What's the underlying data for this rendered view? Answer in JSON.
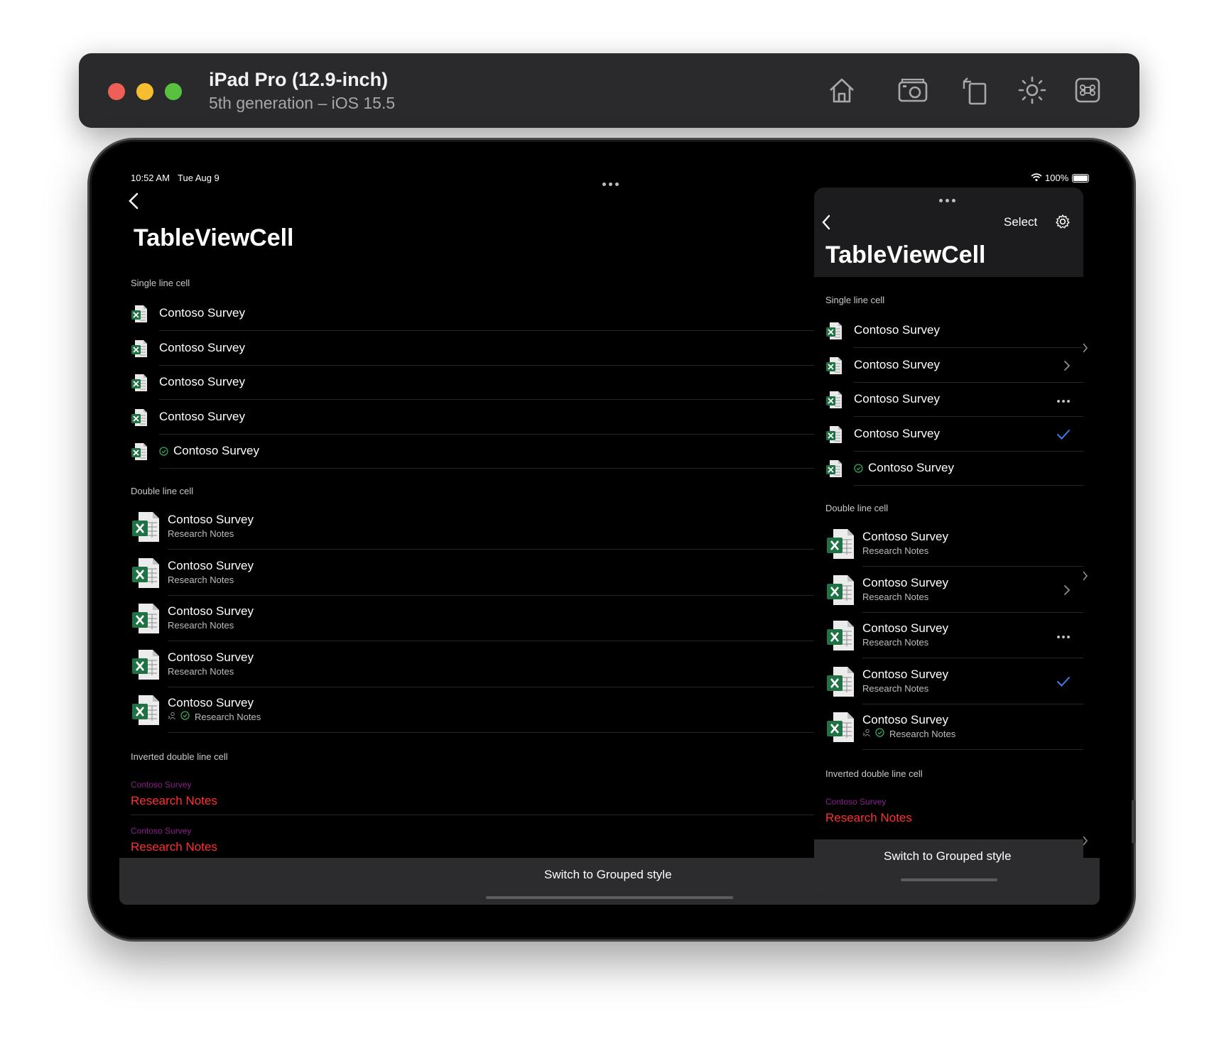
{
  "simulator": {
    "device_name": "iPad Pro (12.9-inch)",
    "device_detail": "5th generation – iOS 15.5",
    "toolbar_icons": [
      "home-icon",
      "screenshot-icon",
      "rotate-icon",
      "appearance-icon",
      "command-icon"
    ]
  },
  "status_bar": {
    "time": "10:52 AM",
    "date": "Tue Aug 9",
    "battery": "100%"
  },
  "main": {
    "title": "TableViewCell",
    "single_section": "Single line cell",
    "single_rows": [
      "Contoso Survey",
      "Contoso Survey",
      "Contoso Survey",
      "Contoso Survey",
      "Contoso Survey"
    ],
    "double_section": "Double line cell",
    "double_rows": [
      {
        "title": "Contoso Survey",
        "subtitle": "Research Notes"
      },
      {
        "title": "Contoso Survey",
        "subtitle": "Research Notes"
      },
      {
        "title": "Contoso Survey",
        "subtitle": "Research Notes"
      },
      {
        "title": "Contoso Survey",
        "subtitle": "Research Notes"
      },
      {
        "title": "Contoso Survey",
        "subtitle": "Research Notes"
      }
    ],
    "inverted_section": "Inverted double line cell",
    "inverted_rows": [
      {
        "top": "Contoso Survey",
        "bottom": "Research Notes"
      },
      {
        "top": "Contoso Survey",
        "bottom": "Research Notes"
      }
    ],
    "bottom_button": "Switch to Grouped style"
  },
  "popover": {
    "select_label": "Select",
    "title": "TableViewCell",
    "single_section": "Single line cell",
    "single_rows": [
      {
        "label": "Contoso Survey",
        "accessory": "none"
      },
      {
        "label": "Contoso Survey",
        "accessory": "chevron"
      },
      {
        "label": "Contoso Survey",
        "accessory": "more"
      },
      {
        "label": "Contoso Survey",
        "accessory": "checkmark"
      },
      {
        "label": "Contoso Survey",
        "accessory": "none"
      }
    ],
    "double_section": "Double line cell",
    "double_rows": [
      {
        "title": "Contoso Survey",
        "subtitle": "Research Notes",
        "accessory": "none"
      },
      {
        "title": "Contoso Survey",
        "subtitle": "Research Notes",
        "accessory": "chevron"
      },
      {
        "title": "Contoso Survey",
        "subtitle": "Research Notes",
        "accessory": "more"
      },
      {
        "title": "Contoso Survey",
        "subtitle": "Research Notes",
        "accessory": "checkmark"
      },
      {
        "title": "Contoso Survey",
        "subtitle": "Research Notes",
        "accessory": "none"
      }
    ],
    "inverted_section": "Inverted double line cell",
    "inverted_rows": [
      {
        "top": "Contoso Survey",
        "bottom": "Research Notes"
      }
    ],
    "bottom_button": "Switch to Grouped style"
  },
  "colors": {
    "checkmark": "#3d7df2",
    "inverted_top": "#8b1f8b",
    "inverted_bottom": "#ff3030",
    "excel_green": "#1f7244",
    "status_green": "#3aa35a"
  }
}
